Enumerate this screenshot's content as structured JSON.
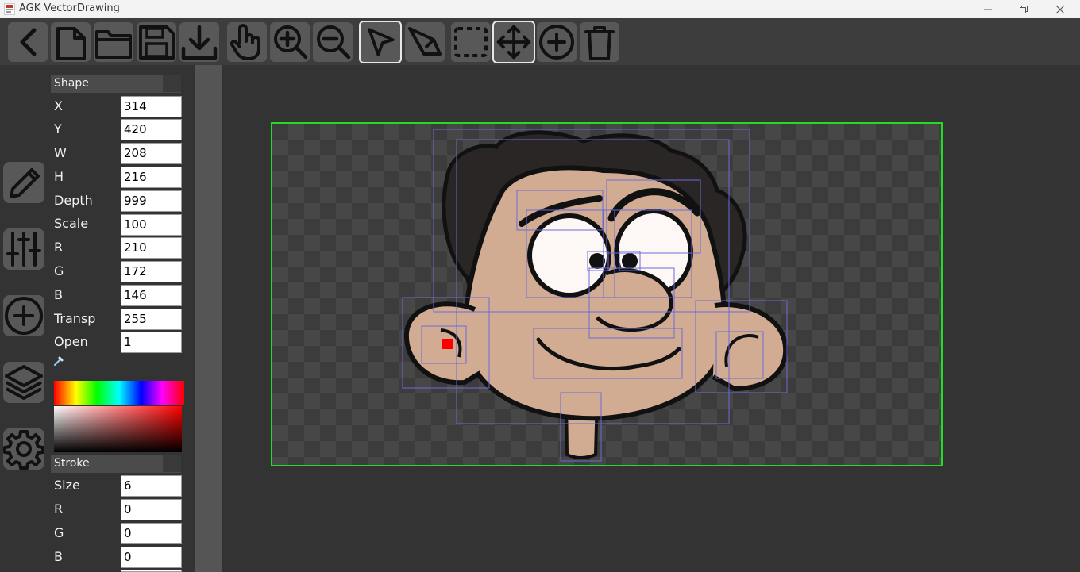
{
  "window": {
    "title": "AGK VectorDrawing"
  },
  "toolbar": {
    "buttons": [
      {
        "name": "back",
        "icon": "chevron-left-icon",
        "active": false
      },
      {
        "name": "new-file",
        "icon": "file-icon",
        "active": false
      },
      {
        "name": "open-folder",
        "icon": "folder-icon",
        "active": false
      },
      {
        "name": "save",
        "icon": "floppy-disk-icon",
        "active": false
      },
      {
        "name": "export",
        "icon": "download-icon",
        "active": false
      },
      {
        "name": "pan",
        "icon": "hand-pointer-icon",
        "active": false
      },
      {
        "name": "zoom-in",
        "icon": "zoom-in-icon",
        "active": false
      },
      {
        "name": "zoom-out",
        "icon": "zoom-out-icon",
        "active": false
      },
      {
        "name": "select",
        "icon": "arrow-cursor-icon",
        "active": true
      },
      {
        "name": "edit-points",
        "icon": "arrow-edit-icon",
        "active": false
      },
      {
        "name": "marquee",
        "icon": "dashed-rect-icon",
        "active": false
      },
      {
        "name": "move",
        "icon": "move-arrows-icon",
        "active": true
      },
      {
        "name": "add",
        "icon": "plus-circle-icon",
        "active": false
      },
      {
        "name": "delete",
        "icon": "trash-icon",
        "active": false
      }
    ]
  },
  "sidebar": {
    "items": [
      {
        "name": "draw",
        "icon": "pencil-icon"
      },
      {
        "name": "adjust",
        "icon": "sliders-icon"
      },
      {
        "name": "add-shape",
        "icon": "plus-circle-icon"
      },
      {
        "name": "layers",
        "icon": "layers-icon"
      },
      {
        "name": "settings",
        "icon": "gear-icon"
      }
    ]
  },
  "shape": {
    "header": "Shape",
    "labels": {
      "x": "X",
      "y": "Y",
      "w": "W",
      "h": "H",
      "depth": "Depth",
      "scale": "Scale",
      "r": "R",
      "g": "G",
      "b": "B",
      "transp": "Transp",
      "open": "Open"
    },
    "values": {
      "x": "314",
      "y": "420",
      "w": "208",
      "h": "216",
      "depth": "999",
      "scale": "100",
      "r": "210",
      "g": "172",
      "b": "146",
      "transp": "255",
      "open": "1"
    }
  },
  "stroke": {
    "header": "Stroke",
    "labels": {
      "size": "Size",
      "r": "R",
      "g": "G",
      "b": "B"
    },
    "values": {
      "size": "6",
      "r": "0",
      "g": "0",
      "b": "0"
    }
  },
  "colors": {
    "canvas_border": "#22dd22",
    "bbox": "#6b6bd6",
    "skin": "#d2ac92",
    "hair": "#2a2626",
    "selected_point": "#ff0000"
  }
}
